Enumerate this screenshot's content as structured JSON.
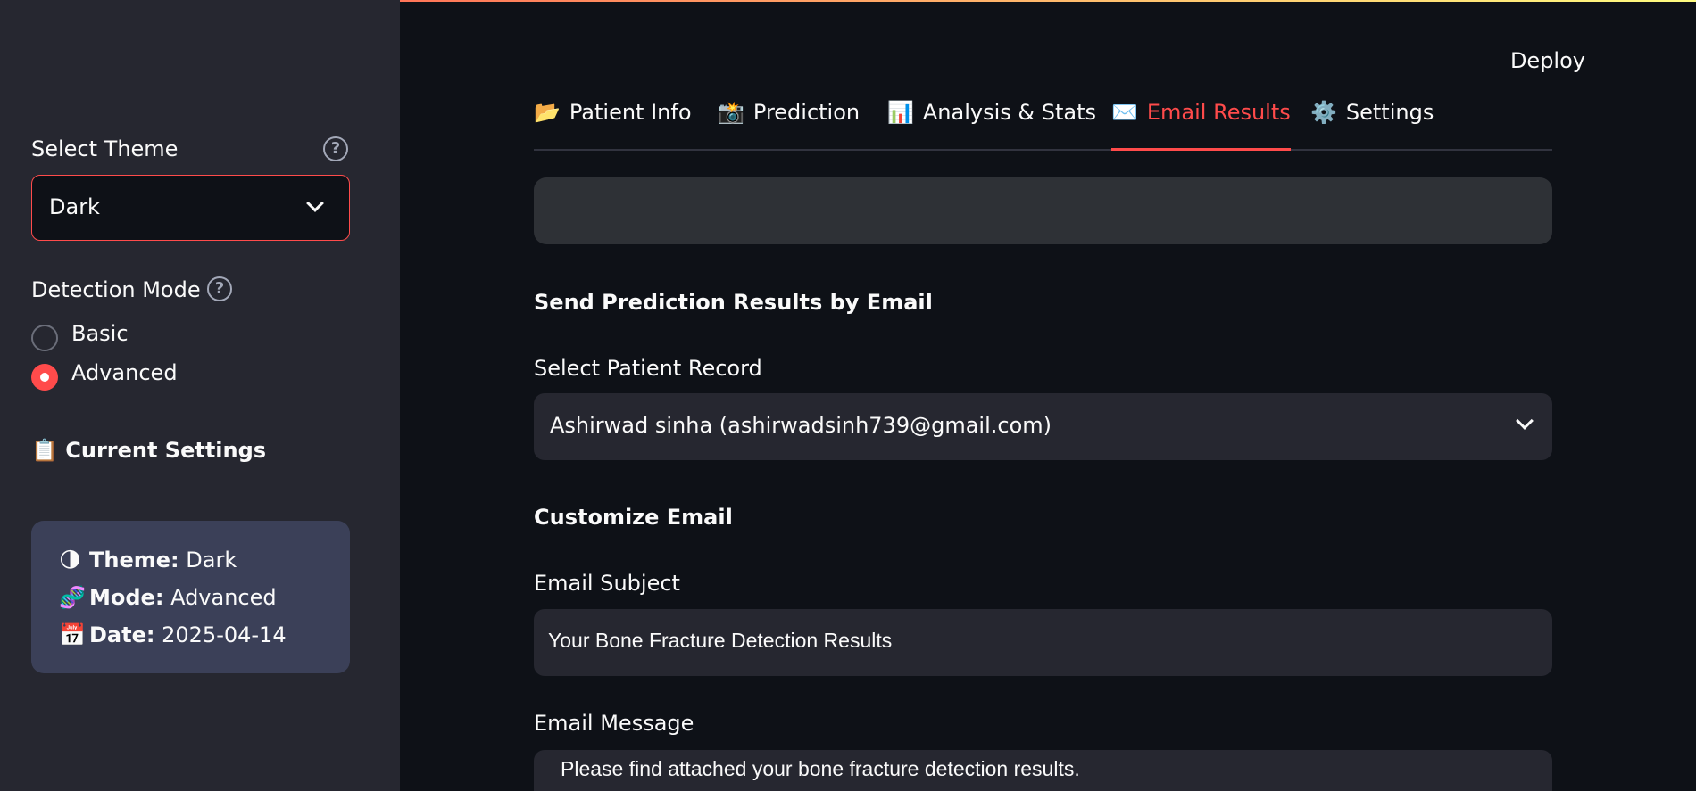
{
  "header": {
    "deploy_label": "Deploy"
  },
  "sidebar": {
    "theme": {
      "label": "Select Theme",
      "value": "Dark",
      "help": "?"
    },
    "detection_mode": {
      "label": "Detection Mode",
      "help": "?",
      "options": [
        {
          "label": "Basic",
          "selected": false
        },
        {
          "label": "Advanced",
          "selected": true
        }
      ]
    },
    "current_settings": {
      "title": "📋 Current Settings",
      "rows": [
        {
          "icon": "🌗",
          "key": "Theme:",
          "value": "Dark"
        },
        {
          "icon": "🧬",
          "key": "Mode:",
          "value": "Advanced"
        },
        {
          "icon": "📅",
          "key": "Date:",
          "value": "2025-04-14"
        }
      ]
    }
  },
  "tabs": [
    {
      "icon": "📂",
      "label": "Patient Info",
      "active": false
    },
    {
      "icon": "📸",
      "label": "Prediction",
      "active": false
    },
    {
      "icon": "📊",
      "label": "Analysis & Stats",
      "active": false
    },
    {
      "icon": "✉️",
      "label": "Email Results",
      "active": true
    },
    {
      "icon": "⚙️",
      "label": "Settings",
      "active": false
    }
  ],
  "email": {
    "section_title": "Send Prediction Results by Email",
    "patient_record_label": "Select Patient Record",
    "patient_record_value": "Ashirwad sinha (ashirwadsinh739@gmail.com)",
    "customize_title": "Customize Email",
    "subject_label": "Email Subject",
    "subject_value": "Your Bone Fracture Detection Results",
    "message_label": "Email Message",
    "message_value": "Please find attached your bone fracture detection results."
  },
  "colors": {
    "accent": "#ff4b4b",
    "background": "#0e1117",
    "sidebar": "#262730",
    "card": "#3b4058"
  }
}
